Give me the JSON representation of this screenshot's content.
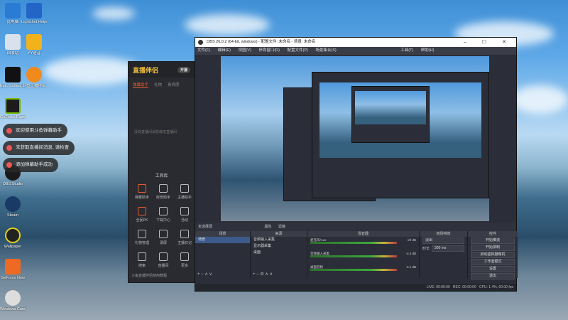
{
  "desktop": {
    "icons": [
      {
        "label": "此电脑",
        "color": "#2a7bd4"
      },
      {
        "label": "Lightshot Helper",
        "color": "#2265c7"
      },
      {
        "label": "回收站",
        "color": "#d9e2ec"
      },
      {
        "label": "YY语音",
        "color": "#f2b21c"
      },
      {
        "label": "Epic Games Launcher",
        "color": "#111111"
      },
      {
        "label": "斗鱼直播伴侣",
        "color": "#f08a1d"
      },
      {
        "label": "GeForce Experience",
        "color": "#1c1c1c"
      },
      {
        "label": "Google Chrome",
        "color": "#dddddd"
      },
      {
        "label": "OBS Studio",
        "color": "#1b1b1b"
      },
      {
        "label": "Steam",
        "color": "#1a3a66"
      },
      {
        "label": "Wallpaper",
        "color": "#e2d11b"
      },
      {
        "label": "GeForce Now",
        "color": "#ee6a22"
      },
      {
        "label": "Windows Camera",
        "color": "#dddddd"
      }
    ],
    "toasts": [
      "欢迎使用斗鱼弹幕助手",
      "未获取直播间消息, 请检查",
      "添加弹幕助手成功"
    ]
  },
  "helper": {
    "brand": "直播伴侣",
    "header_button": "开播",
    "tabs": [
      "弹幕助手",
      "礼物",
      "贵宾席"
    ],
    "empty_text": "没有直播间消息或无直播间",
    "tools_title": "工具库",
    "tools": [
      {
        "label": "弹幕助手",
        "color": "#e85c2f"
      },
      {
        "label": "房管助手",
        "color": "#bbbbbb"
      },
      {
        "label": "主播助手",
        "color": "#bbbbbb"
      },
      {
        "label": "全民PK",
        "color": "#e85c2f"
      },
      {
        "label": "下载中心",
        "color": "#bbbbbb"
      },
      {
        "label": "活动",
        "color": "#bbbbbb"
      },
      {
        "label": "礼物管理",
        "color": "#bbbbbb"
      },
      {
        "label": "录屏",
        "color": "#bbbbbb"
      },
      {
        "label": "主播日记",
        "color": "#bbbbbb"
      },
      {
        "label": "搜索",
        "color": "#bbbbbb"
      },
      {
        "label": "直播间",
        "color": "#bbbbbb"
      },
      {
        "label": "更多",
        "color": "#bbbbbb"
      }
    ],
    "footer": "斗鱼直播伴侣使用教程"
  },
  "obs": {
    "title": "OBS 26.0.2 (64-bit, windows) - 配置文件: 未命名 - 场景: 未命名",
    "menu": [
      "文件(F)",
      "编辑(E)",
      "视图(V)",
      "停靠窗口(D)",
      "配置文件(P)",
      "场景集合(S)",
      "工具(T)",
      "帮助(H)"
    ],
    "scene_label": "未选择源",
    "properties_label": "属性",
    "filters_label": "滤镜",
    "docks": {
      "scenes": {
        "header": "场景",
        "items": [
          "场景"
        ]
      },
      "sources": {
        "header": "来源",
        "items": [
          "音频输入采集",
          "显示器采集",
          "桌面"
        ]
      },
      "mixer": {
        "header": "混音器",
        "channels": [
          {
            "name": "麦克风/Aux",
            "db": "-inf dB"
          },
          {
            "name": "音频输入采集",
            "db": "-3.4 dB"
          },
          {
            "name": "桌面音频",
            "db": "-3.1 dB"
          }
        ]
      },
      "transitions": {
        "header": "转场特效",
        "mode": "淡出",
        "duration_label": "时长",
        "duration": "300 ms"
      },
      "controls": {
        "header": "控件",
        "buttons": [
          "开始推流",
          "开始录制",
          "启动虚拟摄像机",
          "工作室模式",
          "设置",
          "退出"
        ]
      }
    },
    "status": {
      "live": "LIVE: 00:00:00",
      "rec": "REC: 00:00:00",
      "cpu": "CPU: 1.4%, 60.00 fps"
    }
  }
}
